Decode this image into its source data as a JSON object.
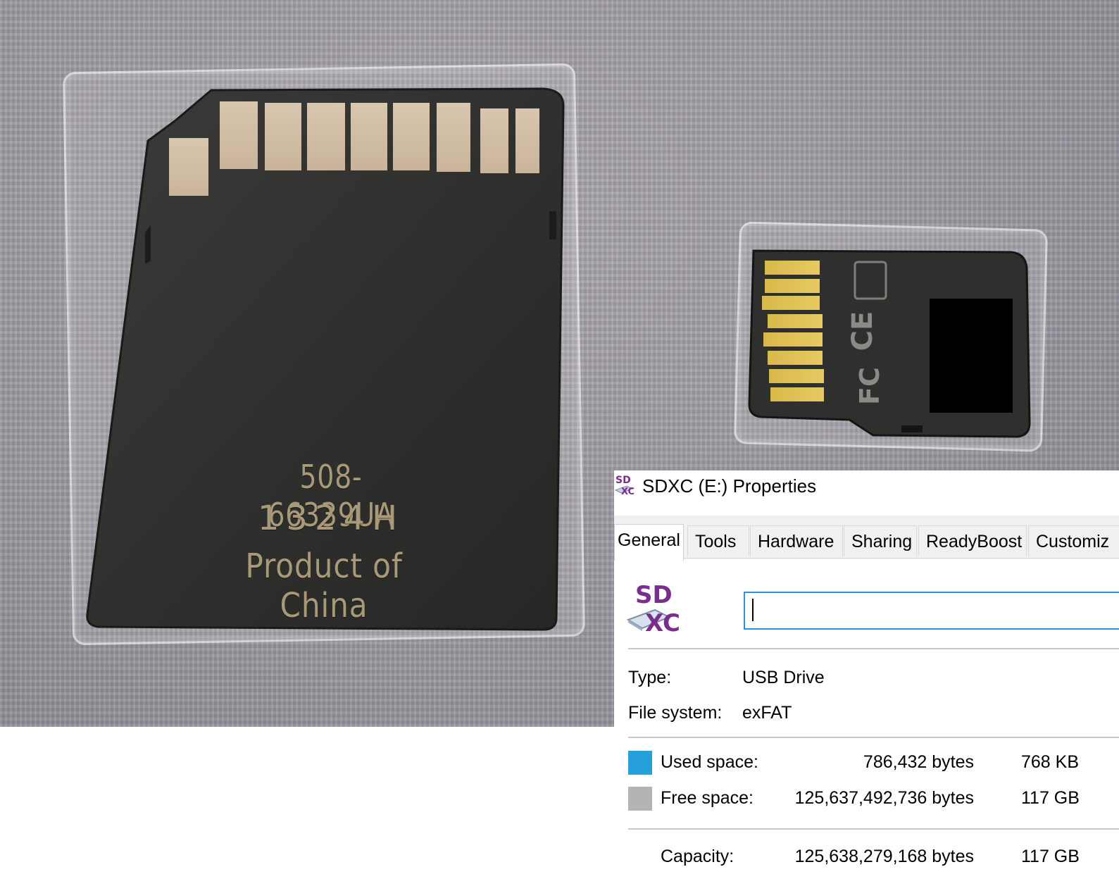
{
  "photo": {
    "sd_card": {
      "engraving": [
        "508-66339UA",
        "1324H",
        "Product of China"
      ]
    },
    "microsd_card": {
      "markings": [
        "FC",
        "CE"
      ]
    }
  },
  "dialog": {
    "title": "SDXC (E:) Properties",
    "title_icon": "sdxc-drive-icon",
    "drive_icon_text_top": "SD",
    "drive_icon_text_bottom": "XC",
    "tabs": [
      {
        "label": "General",
        "selected": true
      },
      {
        "label": "Tools"
      },
      {
        "label": "Hardware"
      },
      {
        "label": "Sharing"
      },
      {
        "label": "ReadyBoost"
      },
      {
        "label": "Customiz"
      }
    ],
    "volume_label_value": "",
    "type_label": "Type:",
    "type_value": "USB Drive",
    "fs_label": "File system:",
    "fs_value": "exFAT",
    "used": {
      "label": "Used space:",
      "bytes": "786,432 bytes",
      "size": "768 KB",
      "color": "#26a0da"
    },
    "free": {
      "label": "Free space:",
      "bytes": "125,637,492,736 bytes",
      "size": "117 GB",
      "color": "#b4b4b4"
    },
    "capacity": {
      "label": "Capacity:",
      "bytes": "125,638,279,168 bytes",
      "size": "117 GB"
    }
  }
}
